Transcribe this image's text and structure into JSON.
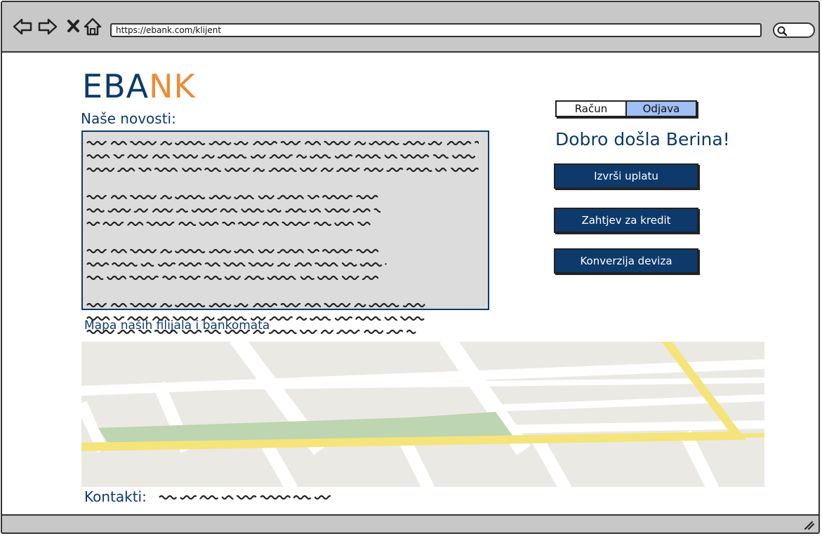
{
  "browser": {
    "url": "https://ebank.com/klijent",
    "icons": [
      "back-arrow-icon",
      "forward-arrow-icon",
      "close-x-icon",
      "home-icon",
      "search-icon",
      "resize-grip-icon"
    ]
  },
  "logo": {
    "part1": "EBA",
    "part2": "NK"
  },
  "news": {
    "title": "Naše novosti:",
    "paragraphs": [
      3,
      3,
      3,
      3
    ]
  },
  "tabs": [
    {
      "label": "Račun",
      "active": false
    },
    {
      "label": "Odjava",
      "active": true
    }
  ],
  "welcome": "Dobro došla Berina!",
  "actions": {
    "payment": "Izvrši uplatu",
    "loan": "Zahtjev za kredit",
    "exchange": "Konverzija deviza"
  },
  "map": {
    "title": "Mapa naših filijala i bankomata"
  },
  "contact": {
    "label": "Kontakti:"
  },
  "colors": {
    "brand_blue": "#0e3a6b",
    "brand_orange": "#ee8b35",
    "active_tab": "#9fbff5",
    "news_bg": "#dcdcdc",
    "map_bg": "#ebe9e4",
    "map_park": "#bdd5b0",
    "map_road_yellow": "#f5e47a"
  }
}
